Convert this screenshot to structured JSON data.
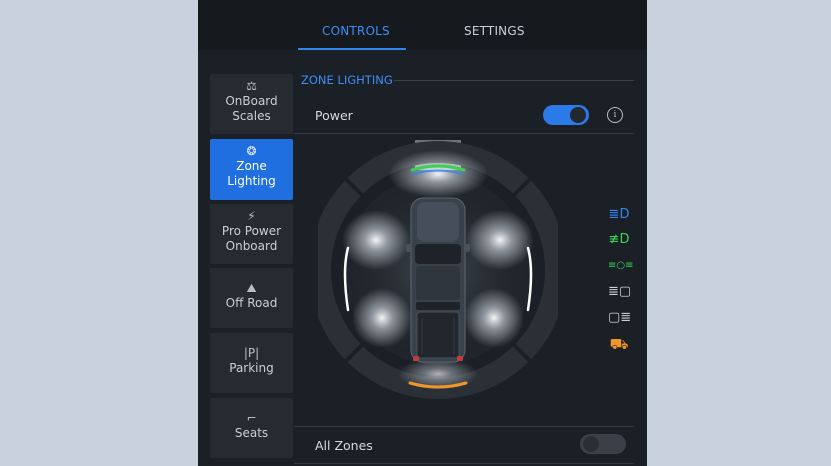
{
  "tabs": {
    "controls": "CONTROLS",
    "settings": "SETTINGS"
  },
  "sidebar": {
    "items": [
      {
        "icon": "onboard-scales-icon",
        "glyph": "⚖",
        "label": "OnBoard\nScales",
        "active": false
      },
      {
        "icon": "zone-lighting-icon",
        "glyph": "❂",
        "label": "Zone\nLighting",
        "active": true
      },
      {
        "icon": "pro-power-icon",
        "glyph": "⚡",
        "label": "Pro Power\nOnboard",
        "active": false
      },
      {
        "icon": "off-road-icon",
        "glyph": "⛰",
        "label": "Off Road",
        "active": false
      },
      {
        "icon": "parking-icon",
        "glyph": "|P|",
        "label": "Parking",
        "active": false
      },
      {
        "icon": "seat-icon",
        "glyph": "⌐",
        "label": "Seats",
        "active": false
      }
    ]
  },
  "zone_lighting": {
    "section_title": "ZONE LIGHTING",
    "power_label": "Power",
    "power_on": true,
    "all_zones_label": "All Zones",
    "all_zones_on": false
  },
  "status_icons": [
    {
      "name": "headlight-icon",
      "glyph": "≣D",
      "color": "#2f86f0"
    },
    {
      "name": "fog-light-icon",
      "glyph": "≢D",
      "color": "#39d353"
    },
    {
      "name": "parking-light-icon",
      "glyph": "≡○≡",
      "color": "#39d353"
    },
    {
      "name": "front-zone-light-icon",
      "glyph": "≣▢",
      "color": "#c9cfd6"
    },
    {
      "name": "rear-zone-light-icon",
      "glyph": "▢≣",
      "color": "#c9cfd6"
    },
    {
      "name": "vehicle-warning-icon",
      "glyph": "⛟",
      "color": "#f0962a"
    }
  ],
  "colors": {
    "accent": "#2f86f0",
    "front_zone": "#39d353",
    "rear_zone": "#f0962a"
  }
}
